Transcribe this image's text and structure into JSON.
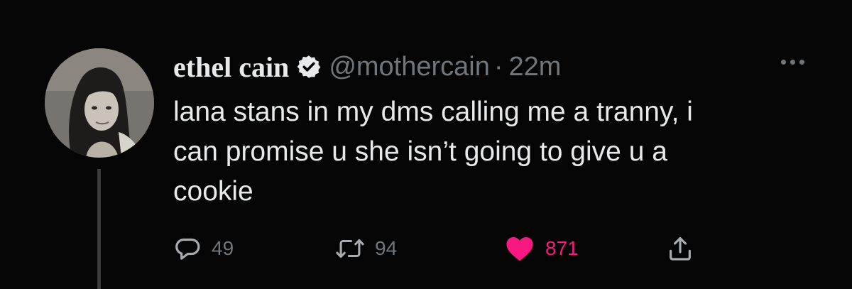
{
  "tweet": {
    "author_name": "ethel cain",
    "handle": "@mothercain",
    "separator": "·",
    "time": "22m",
    "text": "lana stans in my dms calling me a tranny, i\ncan promise u she isn’t going to give u a\ncookie",
    "icons": {
      "avatar": "avatar-photo",
      "verified": "verified-badge-icon",
      "more": "more-options-icon",
      "reply": "reply-icon",
      "retweet": "retweet-icon",
      "like": "heart-icon",
      "share": "share-icon"
    }
  },
  "actions": {
    "reply_count": "49",
    "retweet_count": "94",
    "like_count": "871"
  },
  "colors": {
    "background": "#000000",
    "text": "#e7e9ea",
    "muted": "#71767b",
    "like": "#f91880"
  }
}
